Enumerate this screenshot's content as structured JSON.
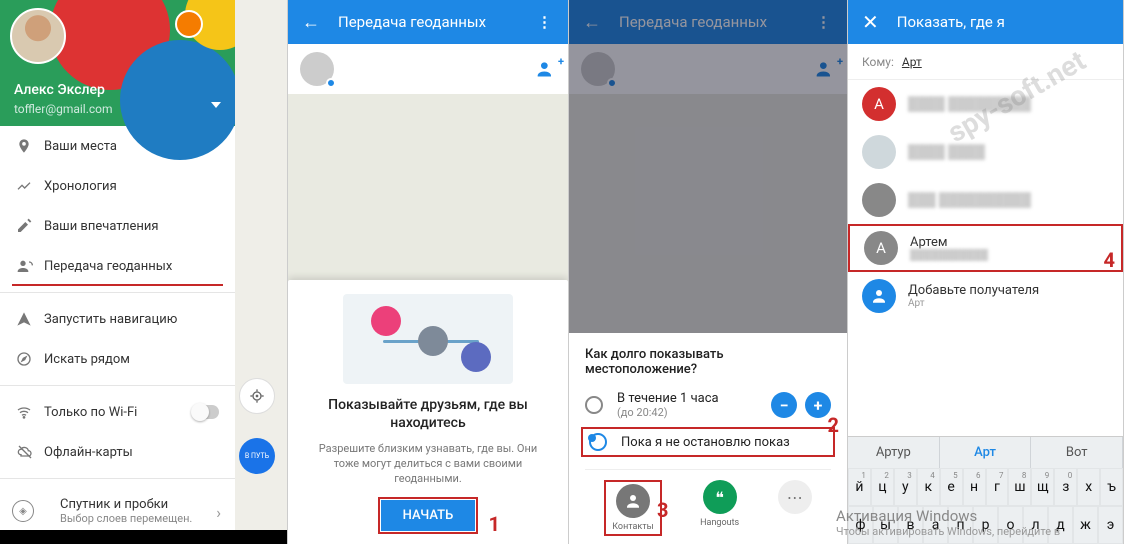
{
  "screen1": {
    "user_name": "Алекс Экслер",
    "user_email": "toffler@gmail.com",
    "items": {
      "places": "Ваши места",
      "timeline": "Хронология",
      "impressions": "Ваши впечатления",
      "geoshare": "Передача геоданных",
      "startnav": "Запустить навигацию",
      "nearby": "Искать рядом",
      "wifi": "Только по Wi-Fi",
      "offline": "Офлайн-карты",
      "sat_title": "Спутник и пробки",
      "sat_sub": "Выбор слоев перемещен."
    },
    "fab": "В ПУТЬ"
  },
  "screen2": {
    "header": "Передача геоданных",
    "card_title": "Показывайте друзьям, где вы находитесь",
    "card_text": "Разрешите близким узнавать, где вы. Они тоже могут делиться с вами своими геоданными.",
    "btn": "НАЧАТЬ",
    "num": "1"
  },
  "screen3": {
    "header": "Передача геоданных",
    "question": "Как долго показывать местоположение?",
    "opt1_l1": "В течение 1 часа",
    "opt1_l2": "(до 20:42)",
    "opt2": "Пока я не остановлю показ",
    "num2": "2",
    "num3": "3",
    "share_contacts": "Контакты",
    "share_hangouts": "Hangouts"
  },
  "screen4": {
    "header": "Показать, где я",
    "to_label": "Кому:",
    "to_value": "Арт",
    "contacts": [
      {
        "letter": "А",
        "name": "",
        "meta": "",
        "cls": "red"
      },
      {
        "letter": "",
        "name": "",
        "meta": "",
        "cls": "img"
      },
      {
        "letter": "",
        "name": "",
        "meta": "",
        "cls": "gray"
      },
      {
        "letter": "А",
        "name": "Артем",
        "meta": "",
        "cls": "gray"
      }
    ],
    "add_title": "Добавьте получателя",
    "add_sub": "Арт",
    "num4": "4",
    "suggestions": [
      "Артур",
      "Арт",
      "Вот"
    ],
    "kb_row1": [
      "й",
      "ц",
      "у",
      "к",
      "е",
      "н",
      "г",
      "ш",
      "щ",
      "з",
      "х",
      "ъ"
    ],
    "kb_row1_sup": [
      "1",
      "2",
      "3",
      "4",
      "5",
      "6",
      "7",
      "8",
      "9",
      "0",
      "",
      ""
    ]
  },
  "watermark": {
    "t": "Активация Windows",
    "s": "Чтобы активировать Windows, перейдите в"
  },
  "wm_site": "spy-soft.net"
}
